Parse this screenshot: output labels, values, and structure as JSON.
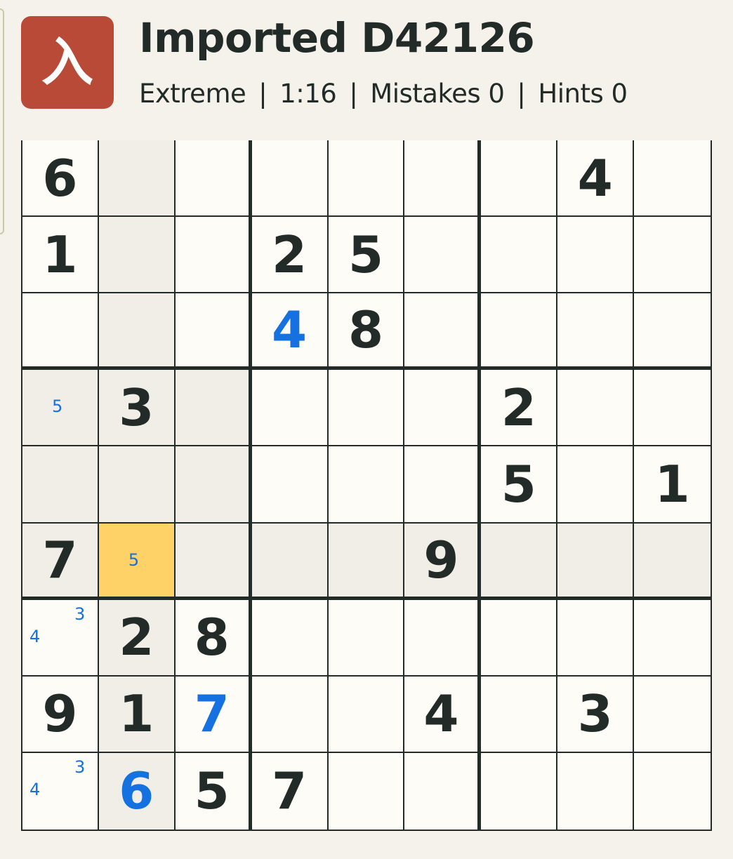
{
  "header": {
    "icon_glyph": "入",
    "icon_name": "app-logo-icon",
    "title": "Imported D42126",
    "difficulty": "Extreme",
    "timer": "1:16",
    "mistakes": "Mistakes 0",
    "hints": "Hints 0",
    "separator": "|"
  },
  "colors": {
    "icon_bg": "#b84a37",
    "given_digit": "#222b27",
    "user_digit": "#1570e0",
    "note": "#1570e0",
    "selected_cell": "#ffd267",
    "highlighted_cell": "#f0eee7",
    "cell_bg": "#fefcf6"
  },
  "selected": {
    "row": 5,
    "col": 1
  },
  "board": [
    [
      {
        "v": "6",
        "t": "given"
      },
      null,
      null,
      null,
      null,
      null,
      null,
      {
        "v": "4",
        "t": "given"
      },
      null
    ],
    [
      {
        "v": "1",
        "t": "given"
      },
      null,
      null,
      {
        "v": "2",
        "t": "given"
      },
      {
        "v": "5",
        "t": "given"
      },
      null,
      null,
      null,
      null
    ],
    [
      null,
      null,
      null,
      {
        "v": "4",
        "t": "user"
      },
      {
        "v": "8",
        "t": "given"
      },
      null,
      null,
      null,
      null
    ],
    [
      {
        "notes": [
          "5"
        ]
      },
      {
        "v": "3",
        "t": "given"
      },
      null,
      null,
      null,
      null,
      {
        "v": "2",
        "t": "given"
      },
      null,
      null
    ],
    [
      null,
      null,
      null,
      null,
      null,
      null,
      {
        "v": "5",
        "t": "given"
      },
      null,
      {
        "v": "1",
        "t": "given"
      }
    ],
    [
      {
        "v": "7",
        "t": "given"
      },
      {
        "notes": [
          "5"
        ]
      },
      null,
      null,
      null,
      {
        "v": "9",
        "t": "given"
      },
      null,
      null,
      null
    ],
    [
      {
        "notes": [
          "3",
          "4"
        ]
      },
      {
        "v": "2",
        "t": "given"
      },
      {
        "v": "8",
        "t": "given"
      },
      null,
      null,
      null,
      null,
      null,
      null
    ],
    [
      {
        "v": "9",
        "t": "given"
      },
      {
        "v": "1",
        "t": "given"
      },
      {
        "v": "7",
        "t": "user"
      },
      null,
      null,
      {
        "v": "4",
        "t": "given"
      },
      null,
      {
        "v": "3",
        "t": "given"
      },
      null
    ],
    [
      {
        "notes": [
          "3",
          "4"
        ]
      },
      {
        "v": "6",
        "t": "user"
      },
      {
        "v": "5",
        "t": "given"
      },
      {
        "v": "7",
        "t": "given"
      },
      null,
      null,
      null,
      null,
      null
    ]
  ]
}
